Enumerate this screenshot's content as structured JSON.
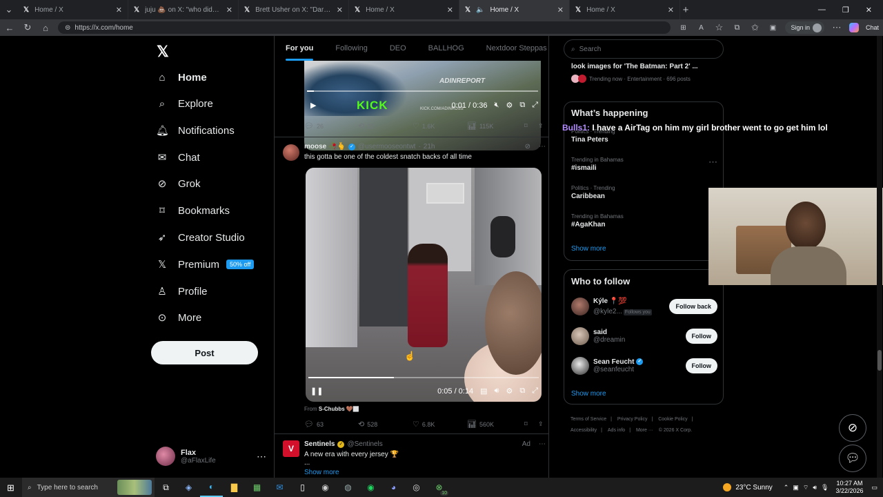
{
  "browser": {
    "tabs": [
      {
        "title": "Home / X",
        "active": false
      },
      {
        "title": "juju 💩 on X: \"who did this 😭😭",
        "active": false
      },
      {
        "title": "Brett Usher on X: \"Darius Garland",
        "active": false
      },
      {
        "title": "Home / X",
        "active": false
      },
      {
        "title": "Home / X",
        "active": true
      },
      {
        "title": "Home / X",
        "active": false
      }
    ],
    "url": "https://x.com/home",
    "signin_label": "Sign in",
    "chat_label": "Chat"
  },
  "nav": {
    "logo": "X",
    "items": [
      {
        "label": "Home",
        "icon": "home-icon"
      },
      {
        "label": "Explore",
        "icon": "search-icon"
      },
      {
        "label": "Notifications",
        "icon": "bell-icon"
      },
      {
        "label": "Chat",
        "icon": "mail-icon"
      },
      {
        "label": "Grok",
        "icon": "grok-icon"
      },
      {
        "label": "Bookmarks",
        "icon": "bookmark-icon"
      },
      {
        "label": "Creator Studio",
        "icon": "rocket-icon"
      },
      {
        "label": "Premium",
        "icon": "x-icon"
      },
      {
        "label": "Profile",
        "icon": "person-icon"
      },
      {
        "label": "More",
        "icon": "more-circle-icon"
      }
    ],
    "premium_badge": "50% off",
    "post_label": "Post",
    "account": {
      "name": "Flax",
      "handle": "@aFlaxLife"
    }
  },
  "feed_tabs": [
    "For you",
    "Following",
    "DEO",
    "BALLHOG",
    "Nextdoor Steppas"
  ],
  "post1": {
    "watermark": "ADINREPORT",
    "brand": "KICK",
    "brand_sub": "KICK.COM/ADINROSS",
    "time": "0:01 / 0:36",
    "progress": 0.03,
    "replies": "26",
    "reposts": "22",
    "likes": "1.6K",
    "views": "115K"
  },
  "post2": {
    "name": "moose 🥀🫰",
    "handle": "@usermooseontwt",
    "age": "21h",
    "text": "this gotta be one of the coldest snatch backs of all time",
    "time": "0:05 / 0:14",
    "progress": 0.37,
    "from_label": "From",
    "from_source": "S-Chubbs 🤎🏾",
    "replies": "63",
    "reposts": "528",
    "likes": "6.8K",
    "views": "560K"
  },
  "post3": {
    "name": "Sentinels",
    "handle": "@Sentinels",
    "ad": "Ad",
    "text": "A new era with every jersey 🏆",
    "ellipsis": "...",
    "show_more": "Show more"
  },
  "right": {
    "search_placeholder": "Search",
    "top_trend": {
      "title": "look images for 'The Batman: Part 2' ...",
      "meta": "Trending now · Entertainment · 696 posts"
    },
    "whats_happening": "What’s happening",
    "trends": [
      {
        "context": "Politics · Trending",
        "name": "Tina Peters"
      },
      {
        "context": "Trending in Bahamas",
        "name": "#ismaili"
      },
      {
        "context": "Politics · Trending",
        "name": "Caribbean"
      },
      {
        "context": "Trending in Bahamas",
        "name": "#AgaKhan"
      }
    ],
    "show_more": "Show more",
    "who_to_follow": "Who to follow",
    "follow_suggestions": [
      {
        "name": "Kýle 📍💯",
        "handle": "@kyle2...",
        "follows_you": "Follows you",
        "button": "Follow back"
      },
      {
        "name": "said",
        "handle": "@dreamin",
        "button": "Follow"
      },
      {
        "name": "Sean Feucht",
        "handle": "@seanfeucht",
        "button": "Follow"
      }
    ],
    "show_more_2": "Show more",
    "footer": [
      "Terms of Service",
      "Privacy Policy",
      "Cookie Policy",
      "Accessibility",
      "Ads info",
      "More ···",
      "© 2026 X Corp."
    ]
  },
  "overlay": {
    "user": "Bulls1:",
    "message": "I have a AirTag on him my girl brother went to go get him lol"
  },
  "taskbar": {
    "search_placeholder": "Type here to search",
    "weather": "23°C  Sunny",
    "time": "10:27 AM",
    "date": "3/22/2026",
    "badge": "10"
  }
}
